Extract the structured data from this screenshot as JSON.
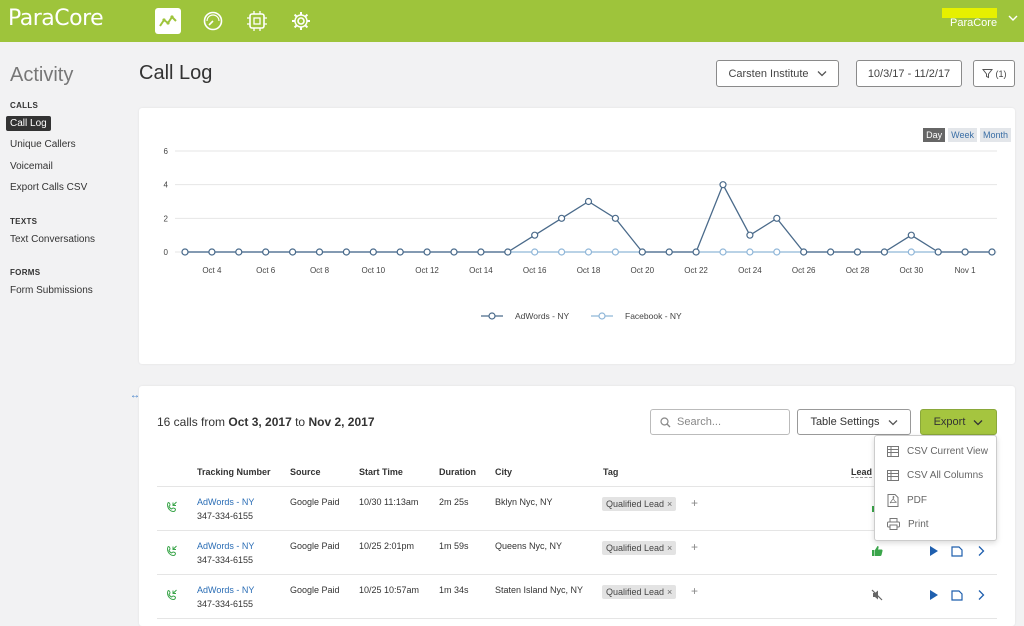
{
  "app": {
    "logo": "ParaCore",
    "user_name": "ParaCore"
  },
  "topnav": {
    "icons": [
      "chart-line-icon",
      "speedometer-icon",
      "chip-icon",
      "gear-icon"
    ]
  },
  "sidebar": {
    "title": "Activity",
    "sections": [
      {
        "label": "CALLS",
        "items": [
          "Call Log",
          "Unique Callers",
          "Voicemail",
          "Export Calls CSV"
        ]
      },
      {
        "label": "TEXTS",
        "items": [
          "Text Conversations"
        ]
      },
      {
        "label": "FORMS",
        "items": [
          "Form Submissions"
        ]
      }
    ],
    "active_item": "Call Log"
  },
  "header": {
    "title": "Call Log",
    "account_select": "Carsten Institute",
    "date_range": "10/3/17 - 11/2/17",
    "filter_count": "(1)"
  },
  "chart": {
    "range_tabs": [
      "Day",
      "Week",
      "Month"
    ],
    "active_range": "Day"
  },
  "chart_data": {
    "type": "line",
    "x": [
      "Oct 3",
      "Oct 4",
      "Oct 5",
      "Oct 6",
      "Oct 7",
      "Oct 8",
      "Oct 9",
      "Oct 10",
      "Oct 11",
      "Oct 12",
      "Oct 13",
      "Oct 14",
      "Oct 15",
      "Oct 16",
      "Oct 17",
      "Oct 18",
      "Oct 19",
      "Oct 20",
      "Oct 21",
      "Oct 22",
      "Oct 23",
      "Oct 24",
      "Oct 25",
      "Oct 26",
      "Oct 27",
      "Oct 28",
      "Oct 29",
      "Oct 30",
      "Oct 31",
      "Nov 1",
      "Nov 2"
    ],
    "x_tick_labels": [
      "Oct 4",
      "Oct 6",
      "Oct 8",
      "Oct 10",
      "Oct 12",
      "Oct 14",
      "Oct 16",
      "Oct 18",
      "Oct 20",
      "Oct 22",
      "Oct 24",
      "Oct 26",
      "Oct 28",
      "Oct 30",
      "Nov 1"
    ],
    "y_ticks": [
      0,
      2,
      4,
      6
    ],
    "ylim": [
      0,
      6
    ],
    "series": [
      {
        "name": "AdWords - NY",
        "color": "#4a6a8a",
        "values": [
          0,
          0,
          0,
          0,
          0,
          0,
          0,
          0,
          0,
          0,
          0,
          0,
          0,
          1,
          2,
          3,
          2,
          0,
          0,
          0,
          4,
          1,
          2,
          0,
          0,
          0,
          0,
          1,
          0,
          0,
          0
        ]
      },
      {
        "name": "Facebook - NY",
        "color": "#8fb6d8",
        "values": [
          0,
          0,
          0,
          0,
          0,
          0,
          0,
          0,
          0,
          0,
          0,
          0,
          0,
          0,
          0,
          0,
          0,
          0,
          0,
          0,
          0,
          0,
          0,
          0,
          0,
          0,
          0,
          0,
          0,
          0,
          0
        ]
      }
    ],
    "grid": true,
    "legend": "bottom-center",
    "title": "",
    "xlabel": "",
    "ylabel": ""
  },
  "table": {
    "summary_prefix": "16 calls from",
    "summary_from": "Oct 3, 2017",
    "summary_to_word": "to",
    "summary_to": "Nov 2, 2017",
    "search_placeholder": "Search...",
    "settings_label": "Table Settings",
    "export_label": "Export",
    "headers": {
      "tracking": "Tracking Number",
      "source": "Source",
      "start": "Start Time",
      "duration": "Duration",
      "city": "City",
      "tag": "Tag",
      "lead": "Lead"
    },
    "rows": [
      {
        "tracking_name": "AdWords - NY",
        "tracking_phone": "347-334-6155",
        "source": "Google Paid",
        "start": "10/30 11:13am",
        "duration": "2m 25s",
        "city": "Bklyn Nyc, NY",
        "tag": "Qualified Lead",
        "tag_remove": "×",
        "tag_add": "+"
      },
      {
        "tracking_name": "AdWords - NY",
        "tracking_phone": "347-334-6155",
        "source": "Google Paid",
        "start": "10/25 2:01pm",
        "duration": "1m 59s",
        "city": "Queens Nyc, NY",
        "tag": "Qualified Lead",
        "tag_remove": "×",
        "tag_add": "+"
      },
      {
        "tracking_name": "AdWords - NY",
        "tracking_phone": "347-334-6155",
        "source": "Google Paid",
        "start": "10/25 10:57am",
        "duration": "1m 34s",
        "city": "Staten Island Nyc, NY",
        "tag": "Qualified Lead",
        "tag_remove": "×",
        "tag_add": "+"
      }
    ]
  },
  "export_menu": {
    "items": [
      {
        "label": "CSV Current View",
        "icon": "table-icon"
      },
      {
        "label": "CSV All Columns",
        "icon": "table-icon"
      },
      {
        "label": "PDF",
        "icon": "pdf-icon"
      },
      {
        "label": "Print",
        "icon": "printer-icon"
      }
    ]
  },
  "colors": {
    "brand": "#9ec43b",
    "export_button": "#a5c53f",
    "link": "#2a6db5",
    "phone_icon": "#3aa54a"
  }
}
